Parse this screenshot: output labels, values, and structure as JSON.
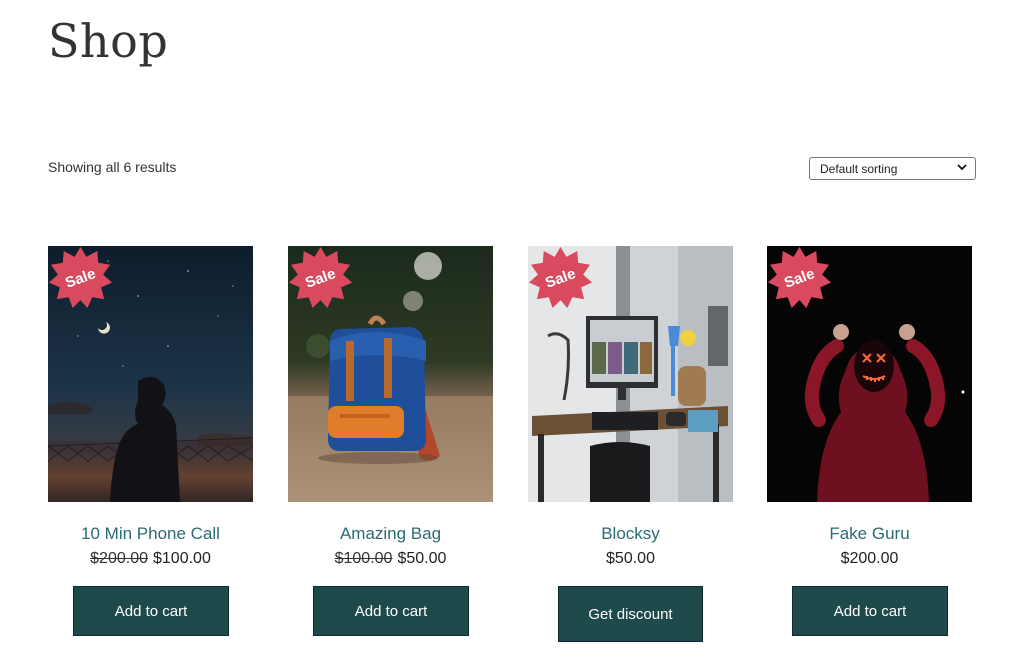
{
  "page": {
    "title": "Shop"
  },
  "toolbar": {
    "result_count": "Showing all 6 results",
    "sort_selected": "Default sorting"
  },
  "badge_label": "Sale",
  "colors": {
    "accent": "#1f4a4c",
    "sale_badge": "#d94a5e",
    "title_link": "#2c6a74"
  },
  "products": [
    {
      "title": "10 Min Phone Call",
      "old_price": "$200.00",
      "price": "$100.00",
      "button": "Add to cart",
      "on_sale": true,
      "image": "night-sky-silhouette"
    },
    {
      "title": "Amazing Bag",
      "old_price": "$100.00",
      "price": "$50.00",
      "button": "Add to cart",
      "on_sale": true,
      "image": "blue-backpack"
    },
    {
      "title": "Blocksy",
      "old_price": "",
      "price": "$50.00",
      "button": "Get discount",
      "on_sale": true,
      "image": "desk-setup"
    },
    {
      "title": "Fake Guru",
      "old_price": "",
      "price": "$200.00",
      "button": "Add to cart",
      "on_sale": true,
      "image": "neon-mask"
    }
  ]
}
